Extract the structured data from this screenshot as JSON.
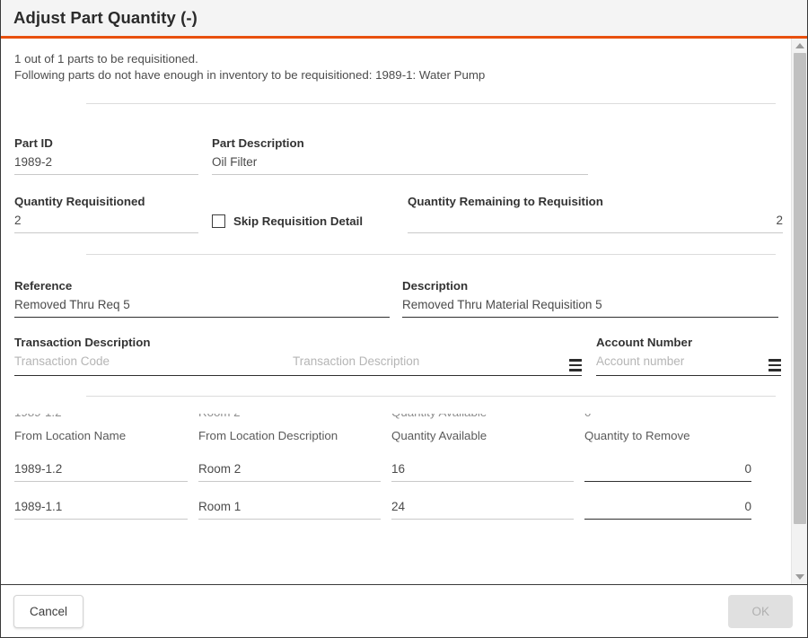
{
  "dialog": {
    "title": "Adjust Part Quantity (-)",
    "accent_color": "#e8500e"
  },
  "notice": {
    "line1": "1 out of 1 parts to be requisitioned.",
    "line2": "Following parts do not have enough in inventory to be requisitioned: 1989-1: Water Pump"
  },
  "fields": {
    "part_id": {
      "label": "Part ID",
      "value": "1989-2"
    },
    "part_description": {
      "label": "Part Description",
      "value": "Oil Filter"
    },
    "quantity_requisitioned": {
      "label": "Quantity Requisitioned",
      "value": "2"
    },
    "skip_requisition_detail": {
      "label": "Skip Requisition Detail",
      "checked": false
    },
    "quantity_remaining": {
      "label": "Quantity Remaining to Requisition",
      "value": "2"
    },
    "reference": {
      "label": "Reference",
      "value": "Removed Thru Req 5"
    },
    "description": {
      "label": "Description",
      "value": "Removed Thru Material Requisition 5"
    },
    "transaction_description": {
      "label": "Transaction Description",
      "code_placeholder": "Transaction Code",
      "desc_placeholder": "Transaction Description"
    },
    "account_number": {
      "label": "Account Number",
      "placeholder": "Account number"
    }
  },
  "table": {
    "headers": [
      "From Location Name",
      "From Location Description",
      "Quantity Available",
      "Quantity to Remove"
    ],
    "rows": [
      {
        "from_location_name": "1989-1.2",
        "from_location_description": "Room 2",
        "quantity_available": "16",
        "quantity_to_remove": "0"
      },
      {
        "from_location_name": "1989-1.1",
        "from_location_description": "Room 1",
        "quantity_available": "24",
        "quantity_to_remove": "0"
      }
    ]
  },
  "footer": {
    "cancel_label": "Cancel",
    "ok_label": "OK",
    "ok_disabled": true
  }
}
